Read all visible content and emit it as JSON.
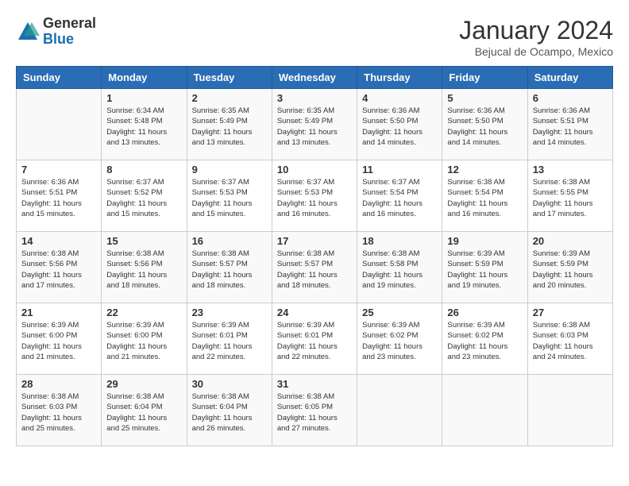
{
  "logo": {
    "general": "General",
    "blue": "Blue"
  },
  "title": "January 2024",
  "location": "Bejucal de Ocampo, Mexico",
  "weekdays": [
    "Sunday",
    "Monday",
    "Tuesday",
    "Wednesday",
    "Thursday",
    "Friday",
    "Saturday"
  ],
  "weeks": [
    [
      {
        "day": "",
        "detail": ""
      },
      {
        "day": "1",
        "detail": "Sunrise: 6:34 AM\nSunset: 5:48 PM\nDaylight: 11 hours\nand 13 minutes."
      },
      {
        "day": "2",
        "detail": "Sunrise: 6:35 AM\nSunset: 5:49 PM\nDaylight: 11 hours\nand 13 minutes."
      },
      {
        "day": "3",
        "detail": "Sunrise: 6:35 AM\nSunset: 5:49 PM\nDaylight: 11 hours\nand 13 minutes."
      },
      {
        "day": "4",
        "detail": "Sunrise: 6:36 AM\nSunset: 5:50 PM\nDaylight: 11 hours\nand 14 minutes."
      },
      {
        "day": "5",
        "detail": "Sunrise: 6:36 AM\nSunset: 5:50 PM\nDaylight: 11 hours\nand 14 minutes."
      },
      {
        "day": "6",
        "detail": "Sunrise: 6:36 AM\nSunset: 5:51 PM\nDaylight: 11 hours\nand 14 minutes."
      }
    ],
    [
      {
        "day": "7",
        "detail": "Sunrise: 6:36 AM\nSunset: 5:51 PM\nDaylight: 11 hours\nand 15 minutes."
      },
      {
        "day": "8",
        "detail": "Sunrise: 6:37 AM\nSunset: 5:52 PM\nDaylight: 11 hours\nand 15 minutes."
      },
      {
        "day": "9",
        "detail": "Sunrise: 6:37 AM\nSunset: 5:53 PM\nDaylight: 11 hours\nand 15 minutes."
      },
      {
        "day": "10",
        "detail": "Sunrise: 6:37 AM\nSunset: 5:53 PM\nDaylight: 11 hours\nand 16 minutes."
      },
      {
        "day": "11",
        "detail": "Sunrise: 6:37 AM\nSunset: 5:54 PM\nDaylight: 11 hours\nand 16 minutes."
      },
      {
        "day": "12",
        "detail": "Sunrise: 6:38 AM\nSunset: 5:54 PM\nDaylight: 11 hours\nand 16 minutes."
      },
      {
        "day": "13",
        "detail": "Sunrise: 6:38 AM\nSunset: 5:55 PM\nDaylight: 11 hours\nand 17 minutes."
      }
    ],
    [
      {
        "day": "14",
        "detail": "Sunrise: 6:38 AM\nSunset: 5:56 PM\nDaylight: 11 hours\nand 17 minutes."
      },
      {
        "day": "15",
        "detail": "Sunrise: 6:38 AM\nSunset: 5:56 PM\nDaylight: 11 hours\nand 18 minutes."
      },
      {
        "day": "16",
        "detail": "Sunrise: 6:38 AM\nSunset: 5:57 PM\nDaylight: 11 hours\nand 18 minutes."
      },
      {
        "day": "17",
        "detail": "Sunrise: 6:38 AM\nSunset: 5:57 PM\nDaylight: 11 hours\nand 18 minutes."
      },
      {
        "day": "18",
        "detail": "Sunrise: 6:38 AM\nSunset: 5:58 PM\nDaylight: 11 hours\nand 19 minutes."
      },
      {
        "day": "19",
        "detail": "Sunrise: 6:39 AM\nSunset: 5:59 PM\nDaylight: 11 hours\nand 19 minutes."
      },
      {
        "day": "20",
        "detail": "Sunrise: 6:39 AM\nSunset: 5:59 PM\nDaylight: 11 hours\nand 20 minutes."
      }
    ],
    [
      {
        "day": "21",
        "detail": "Sunrise: 6:39 AM\nSunset: 6:00 PM\nDaylight: 11 hours\nand 21 minutes."
      },
      {
        "day": "22",
        "detail": "Sunrise: 6:39 AM\nSunset: 6:00 PM\nDaylight: 11 hours\nand 21 minutes."
      },
      {
        "day": "23",
        "detail": "Sunrise: 6:39 AM\nSunset: 6:01 PM\nDaylight: 11 hours\nand 22 minutes."
      },
      {
        "day": "24",
        "detail": "Sunrise: 6:39 AM\nSunset: 6:01 PM\nDaylight: 11 hours\nand 22 minutes."
      },
      {
        "day": "25",
        "detail": "Sunrise: 6:39 AM\nSunset: 6:02 PM\nDaylight: 11 hours\nand 23 minutes."
      },
      {
        "day": "26",
        "detail": "Sunrise: 6:39 AM\nSunset: 6:02 PM\nDaylight: 11 hours\nand 23 minutes."
      },
      {
        "day": "27",
        "detail": "Sunrise: 6:38 AM\nSunset: 6:03 PM\nDaylight: 11 hours\nand 24 minutes."
      }
    ],
    [
      {
        "day": "28",
        "detail": "Sunrise: 6:38 AM\nSunset: 6:03 PM\nDaylight: 11 hours\nand 25 minutes."
      },
      {
        "day": "29",
        "detail": "Sunrise: 6:38 AM\nSunset: 6:04 PM\nDaylight: 11 hours\nand 25 minutes."
      },
      {
        "day": "30",
        "detail": "Sunrise: 6:38 AM\nSunset: 6:04 PM\nDaylight: 11 hours\nand 26 minutes."
      },
      {
        "day": "31",
        "detail": "Sunrise: 6:38 AM\nSunset: 6:05 PM\nDaylight: 11 hours\nand 27 minutes."
      },
      {
        "day": "",
        "detail": ""
      },
      {
        "day": "",
        "detail": ""
      },
      {
        "day": "",
        "detail": ""
      }
    ]
  ]
}
